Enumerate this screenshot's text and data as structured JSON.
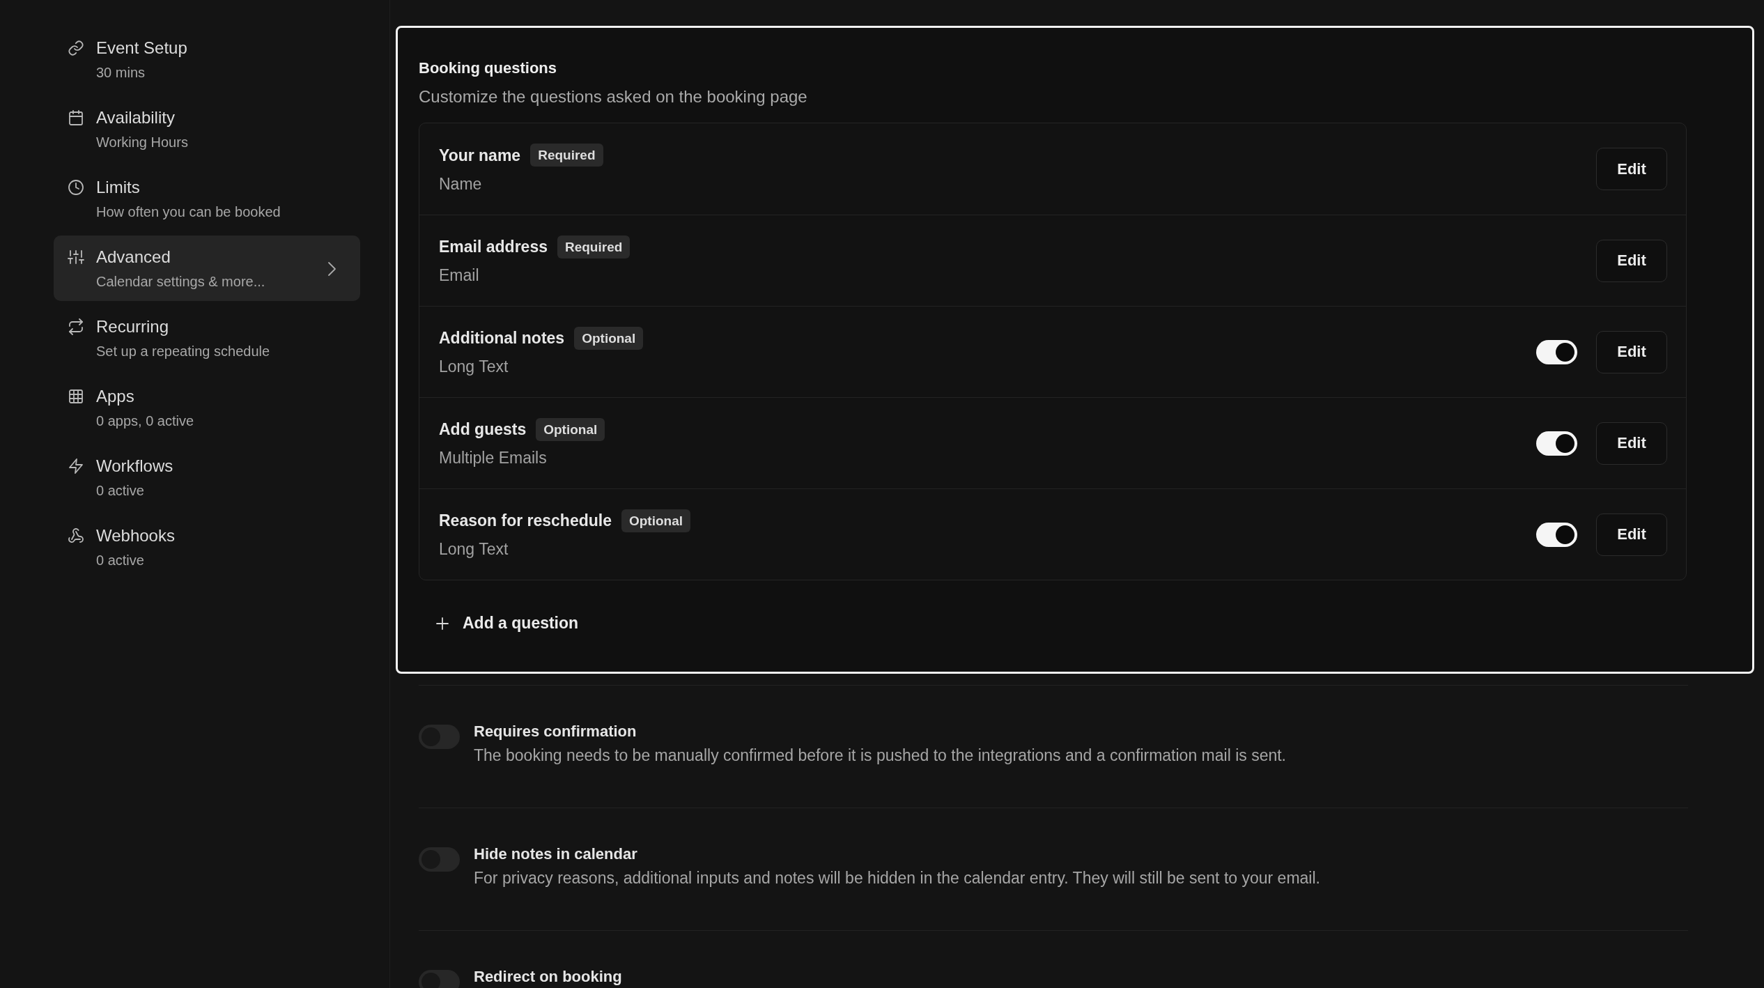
{
  "sidebar": {
    "items": [
      {
        "title": "Event Setup",
        "subtitle": "30 mins",
        "selected": false
      },
      {
        "title": "Availability",
        "subtitle": "Working Hours",
        "selected": false
      },
      {
        "title": "Limits",
        "subtitle": "How often you can be booked",
        "selected": false
      },
      {
        "title": "Advanced",
        "subtitle": "Calendar settings & more...",
        "selected": true
      },
      {
        "title": "Recurring",
        "subtitle": "Set up a repeating schedule",
        "selected": false
      },
      {
        "title": "Apps",
        "subtitle": "0 apps, 0 active",
        "selected": false
      },
      {
        "title": "Workflows",
        "subtitle": "0 active",
        "selected": false
      },
      {
        "title": "Webhooks",
        "subtitle": "0 active",
        "selected": false
      }
    ]
  },
  "booking_questions": {
    "title": "Booking questions",
    "description": "Customize the questions asked on the booking page",
    "questions": [
      {
        "label": "Your name",
        "badge": "Required",
        "type": "Name",
        "edit": "Edit"
      },
      {
        "label": "Email address",
        "badge": "Required",
        "type": "Email",
        "edit": "Edit"
      },
      {
        "label": "Additional notes",
        "badge": "Optional",
        "type": "Long Text",
        "toggle": {
          "on": true
        },
        "edit": "Edit"
      },
      {
        "label": "Add guests",
        "badge": "Optional",
        "type": "Multiple Emails",
        "toggle": {
          "on": true
        },
        "edit": "Edit"
      },
      {
        "label": "Reason for reschedule",
        "badge": "Optional",
        "type": "Long Text",
        "toggle": {
          "on": true
        },
        "edit": "Edit"
      }
    ],
    "add_question": "Add a question"
  },
  "settings": [
    {
      "title": "Requires confirmation",
      "description": "The booking needs to be manually confirmed before it is pushed to the integrations and a confirmation mail is sent.",
      "on": false
    },
    {
      "title": "Hide notes in calendar",
      "description": "For privacy reasons, additional inputs and notes will be hidden in the calendar entry. They will still be sent to your email.",
      "on": false
    },
    {
      "title": "Redirect on booking",
      "on": false
    }
  ]
}
